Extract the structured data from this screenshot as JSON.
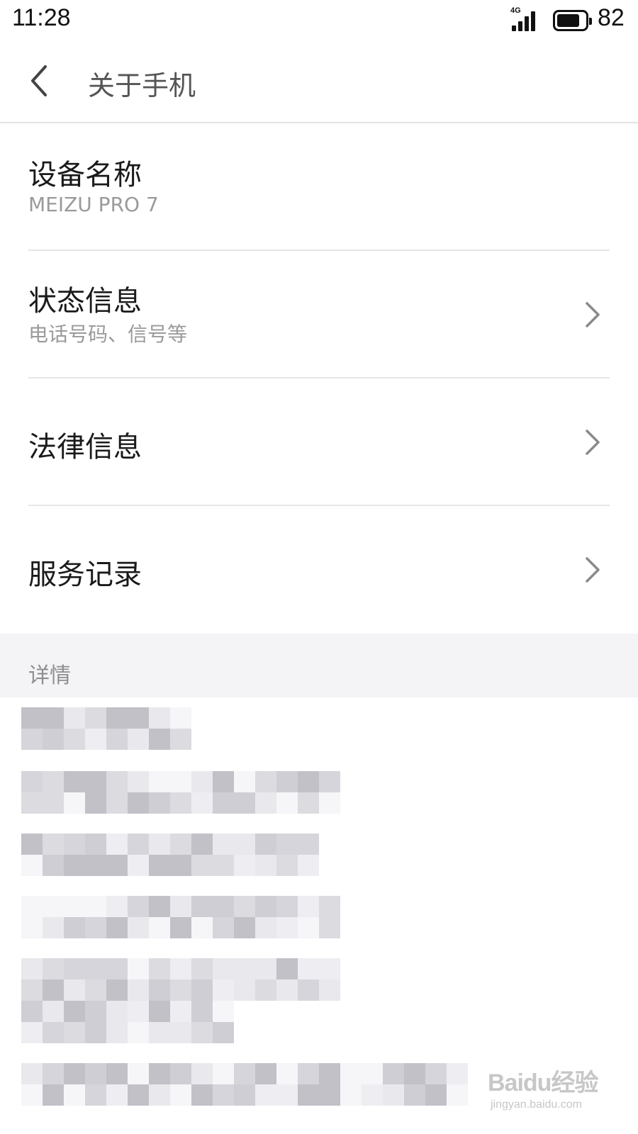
{
  "status_bar": {
    "time": "11:28",
    "network": "4G",
    "battery_level": "82",
    "battery_fraction": 0.82
  },
  "header": {
    "back_icon": "chevron-left-icon",
    "title": "关于手机"
  },
  "items": [
    {
      "title": "设备名称",
      "subtitle": "MEIZU PRO 7",
      "has_chevron": false
    },
    {
      "title": "状态信息",
      "subtitle": "电话号码、信号等",
      "has_chevron": true
    },
    {
      "title": "法律信息",
      "subtitle": "",
      "has_chevron": true
    },
    {
      "title": "服务记录",
      "subtitle": "",
      "has_chevron": true
    }
  ],
  "section": {
    "label": "详情"
  },
  "watermark": {
    "logo_text": "Baidu经验",
    "url": "jingyan.baidu.com"
  },
  "colors": {
    "title_text": "#1a1a1a",
    "subtitle_text": "#9a9a9a",
    "section_bg": "#f4f3f6",
    "divider": "#e6e6e6"
  }
}
